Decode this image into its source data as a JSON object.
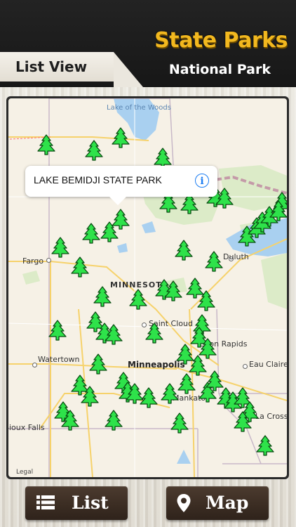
{
  "header": {
    "title": "State Parks",
    "subtitle": "National Park",
    "list_view_label": "List View"
  },
  "map": {
    "callout": "LAKE BEMIDJI STATE PARK",
    "legal": "Legal",
    "state_label": "MINNESOTA",
    "water_labels": [
      "Lake of the Woods"
    ],
    "city_labels": [
      "Fargo",
      "Duluth",
      "Saint Cloud",
      "Coon Rapids",
      "Minneapolis",
      "Eau Claire",
      "Watertown",
      "Sioux Falls",
      "La Crosse",
      "Mankato"
    ],
    "park_marker_icon": "tree-icon"
  },
  "buttons": {
    "list_label": "List",
    "map_label": "Map"
  },
  "colors": {
    "accent_gold": "#f2b81f",
    "tree_green": "#2ee24a",
    "button_brown": "#3a2c22",
    "info_blue": "#1e7ef2"
  }
}
